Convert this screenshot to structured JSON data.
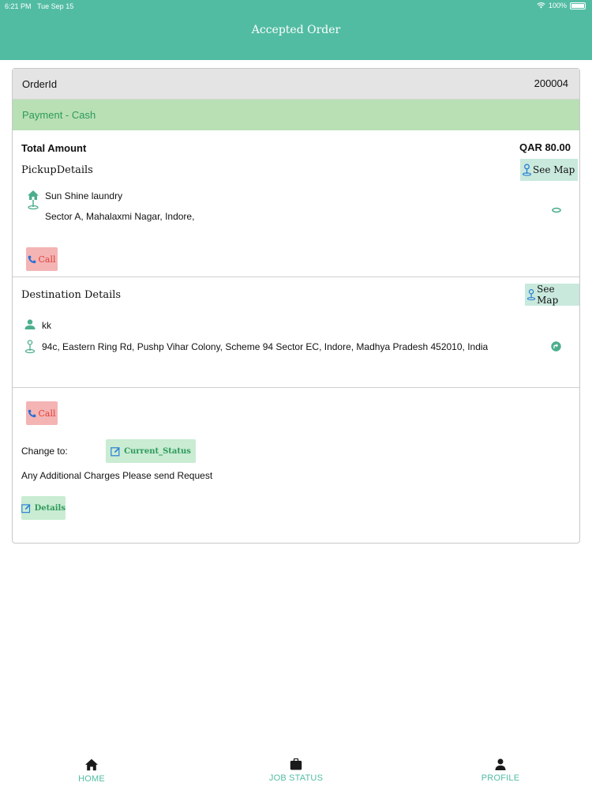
{
  "status_bar": {
    "time": "6:21 PM",
    "date": "Tue Sep 15",
    "battery": "100%"
  },
  "header": {
    "title": "Accepted Order"
  },
  "order": {
    "id_label": "OrderId",
    "id_value": "200004",
    "payment": "Payment - Cash",
    "total_label": "Total Amount",
    "total_value": "QAR 80.00"
  },
  "pickup": {
    "title": "PickupDetails",
    "see_map": "See Map",
    "name": "Sun Shine laundry",
    "address": "Sector A, Mahalaxmi Nagar, Indore,",
    "call": "Call"
  },
  "destination": {
    "title": "Destination Details",
    "see_map": "See Map",
    "name": "kk",
    "address": "94c, Eastern Ring Rd, Pushp Vihar Colony, Scheme 94 Sector EC, Indore, Madhya Pradesh 452010, India"
  },
  "actions": {
    "call": "Call",
    "change_to_label": "Change to:",
    "current_status": "Current_Status",
    "additional_charges": "Any Additional Charges Please send Request",
    "details": "Details"
  },
  "tabs": [
    {
      "label": "HOME",
      "icon": "home-icon"
    },
    {
      "label": "JOB STATUS",
      "icon": "briefcase-icon"
    },
    {
      "label": "PROFILE",
      "icon": "person-icon"
    }
  ],
  "colors": {
    "accent": "#52bca3",
    "payment_bg": "#b8e0b4",
    "call_bg": "#f4b4b4",
    "call_text": "#e0403a",
    "green_btn_bg": "#c9ecd3"
  }
}
